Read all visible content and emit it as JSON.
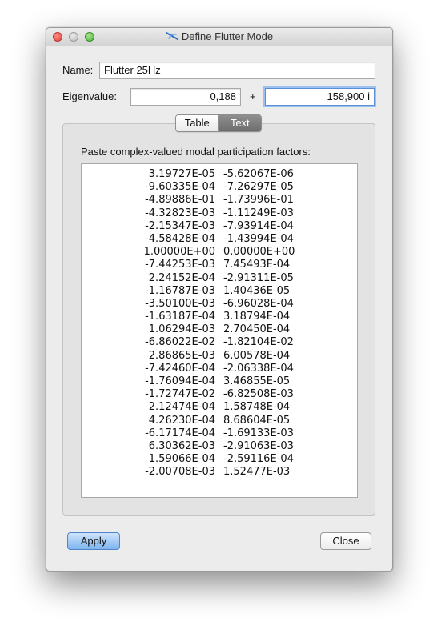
{
  "window": {
    "title": "Define Flutter Mode"
  },
  "form": {
    "name_label": "Name:",
    "name_value": "Flutter 25Hz",
    "eigenvalue_label": "Eigenvalue:",
    "eigen_real": "0,188",
    "plus_sign": "+",
    "eigen_imag": "158,900 i"
  },
  "tabs": [
    {
      "label": "Table",
      "selected": false
    },
    {
      "label": "Text",
      "selected": true
    }
  ],
  "panel": {
    "instruction": "Paste complex-valued modal participation factors:",
    "rows": [
      [
        "3.19727E-05",
        "-5.62067E-06"
      ],
      [
        "-9.60335E-04",
        "-7.26297E-05"
      ],
      [
        "-4.89886E-01",
        "-1.73996E-01"
      ],
      [
        "-4.32823E-03",
        "-1.11249E-03"
      ],
      [
        "-2.15347E-03",
        "-7.93914E-04"
      ],
      [
        "-4.58428E-04",
        "-1.43994E-04"
      ],
      [
        "1.00000E+00",
        "0.00000E+00"
      ],
      [
        "-7.44253E-03",
        "7.45493E-04"
      ],
      [
        "2.24152E-04",
        "-2.91311E-05"
      ],
      [
        "-1.16787E-03",
        "1.40436E-05"
      ],
      [
        "-3.50100E-03",
        "-6.96028E-04"
      ],
      [
        "-1.63187E-04",
        "3.18794E-04"
      ],
      [
        "1.06294E-03",
        "2.70450E-04"
      ],
      [
        "-6.86022E-02",
        "-1.82104E-02"
      ],
      [
        "2.86865E-03",
        "6.00578E-04"
      ],
      [
        "-7.42460E-04",
        "-2.06338E-04"
      ],
      [
        "-1.76094E-04",
        "3.46855E-05"
      ],
      [
        "-1.72747E-02",
        "-6.82508E-03"
      ],
      [
        "2.12474E-04",
        "1.58748E-04"
      ],
      [
        "4.26230E-04",
        "8.68604E-05"
      ],
      [
        "-6.17174E-04",
        "-1.69133E-03"
      ],
      [
        "6.30362E-03",
        "-2.91063E-03"
      ],
      [
        "1.59066E-04",
        "-2.59116E-04"
      ],
      [
        "-2.00708E-03",
        "1.52477E-03"
      ]
    ]
  },
  "buttons": {
    "apply": "Apply",
    "close": "Close"
  },
  "icons": {
    "close": "close-window-icon",
    "minimize": "minimize-window-icon",
    "zoom": "zoom-window-icon",
    "title": "flutter-mode-icon"
  }
}
